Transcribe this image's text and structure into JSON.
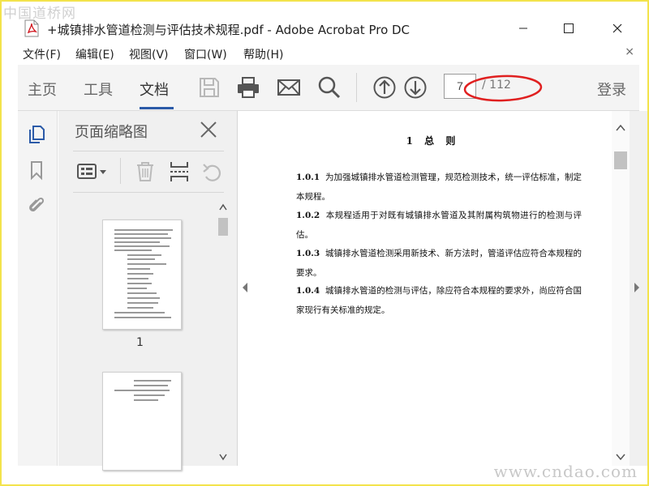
{
  "watermark": {
    "top": "中国道桥网",
    "bottom": "www.cndao.com"
  },
  "window": {
    "title": "+城镇排水管道检测与评估技术规程.pdf - Adobe Acrobat Pro DC",
    "controls": [
      "minimize",
      "maximize",
      "close"
    ]
  },
  "menu": {
    "items": [
      "文件(F)",
      "编辑(E)",
      "视图(V)",
      "窗口(W)",
      "帮助(H)"
    ],
    "close_label": "×"
  },
  "toolbar": {
    "tabs": [
      {
        "label": "主页",
        "active": false
      },
      {
        "label": "工具",
        "active": false
      },
      {
        "label": "文档",
        "active": true
      }
    ],
    "icons": [
      "save-icon",
      "print-icon",
      "mail-icon",
      "search-icon",
      "page-up-icon",
      "page-down-icon"
    ],
    "current_page": "7",
    "total_pages": "/ 112",
    "login_label": "登录",
    "accent_color": "#2b5aa8",
    "highlight_color": "#e02020"
  },
  "sidebar": {
    "rail_icons": [
      "page-thumbnails-icon",
      "bookmark-icon",
      "attachment-icon"
    ],
    "panel_title": "页面缩略图",
    "panel_buttons": [
      "options-menu-icon",
      "delete-icon",
      "insert-page-icon",
      "rotate-icon"
    ],
    "thumbnails": [
      {
        "label": "1"
      },
      {
        "label": ""
      }
    ]
  },
  "document": {
    "heading": "1 总 则",
    "paragraphs": [
      {
        "num": "1.0.1",
        "text": "为加强城镇排水管道检测管理，规范检测技术，统一评估标准，制定本规程。"
      },
      {
        "num": "1.0.2",
        "text": "本规程适用于对既有城镇排水管道及其附属构筑物进行的检测与评估。"
      },
      {
        "num": "1.0.3",
        "text": "城镇排水管道检测采用新技术、新方法时，管道评估应符合本规程的要求。"
      },
      {
        "num": "1.0.4",
        "text": "城镇排水管道的检测与评估，除应符合本规程的要求外，尚应符合国家现行有关标准的规定。"
      }
    ]
  }
}
